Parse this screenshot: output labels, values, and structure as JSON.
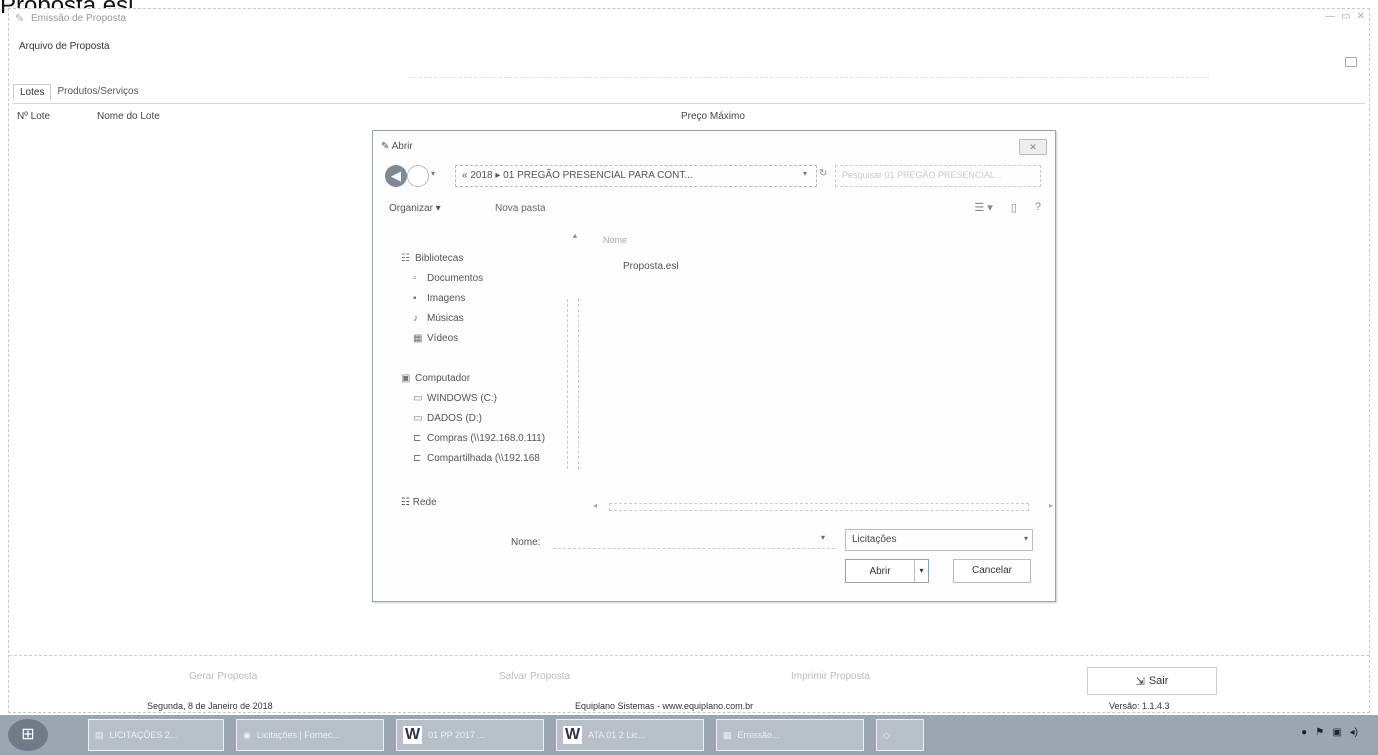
{
  "caption": "Proposta.esl",
  "window": {
    "title": "Emissão de Proposta",
    "min_label": "—",
    "restore_label": "▭",
    "close_label": "✕"
  },
  "menu": {
    "arquivo": "Arquivo de Proposta"
  },
  "tabs": [
    {
      "label": "Lotes"
    },
    {
      "label": "Produtos/Serviços"
    }
  ],
  "columns": {
    "num_lote": "Nº Lote",
    "nome_lote": "Nome do Lote",
    "preco": "Preço Máximo"
  },
  "bottom_buttons": {
    "left": "Gerar Proposta",
    "middle": "Salvar Proposta",
    "right": "Imprimir Proposta",
    "sair": "Sair"
  },
  "status": {
    "date": "Segunda, 8 de Janeiro de 2018",
    "company": "Equiplano Sistemas - www.equiplano.com.br",
    "version": "Versão: 1.1.4.3"
  },
  "dialog": {
    "title": "Abrir",
    "address": "« 2018 ▸ 01 PREGÃO PRESENCIAL PARA CONT...",
    "search_placeholder": "Pesquisar 01 PREGÃO PRESENCIAL...",
    "organize": "Organizar ▾",
    "new_folder": "Nova pasta",
    "column_name": "Nome",
    "nav": {
      "libraries": "Bibliotecas",
      "documents": "Documentos",
      "images": "Imagens",
      "music": "Músicas",
      "videos": "Vídeos",
      "computer": "Computador",
      "windows_c": "WINDOWS (C:)",
      "dados_d": "DADOS (D:)",
      "compras": "Compras (\\\\192.168.0.111)",
      "compartilhada": "Compartilhada (\\\\192.168",
      "rede": "Rede"
    },
    "files": [
      "Proposta.esl"
    ],
    "file_name_label": "Nome:",
    "file_name_value": "",
    "filter": "Licitações",
    "open_button": "Abrir",
    "cancel_button": "Cancelar"
  },
  "taskbar": {
    "tasks": [
      {
        "label": "LICITAÇÕES 2..."
      },
      {
        "label": "Licitações | Fornec..."
      },
      {
        "label": "01 PP 2017 ..."
      },
      {
        "label": "ATA 01 2 Lic..."
      },
      {
        "label": "Emissão..."
      }
    ]
  }
}
